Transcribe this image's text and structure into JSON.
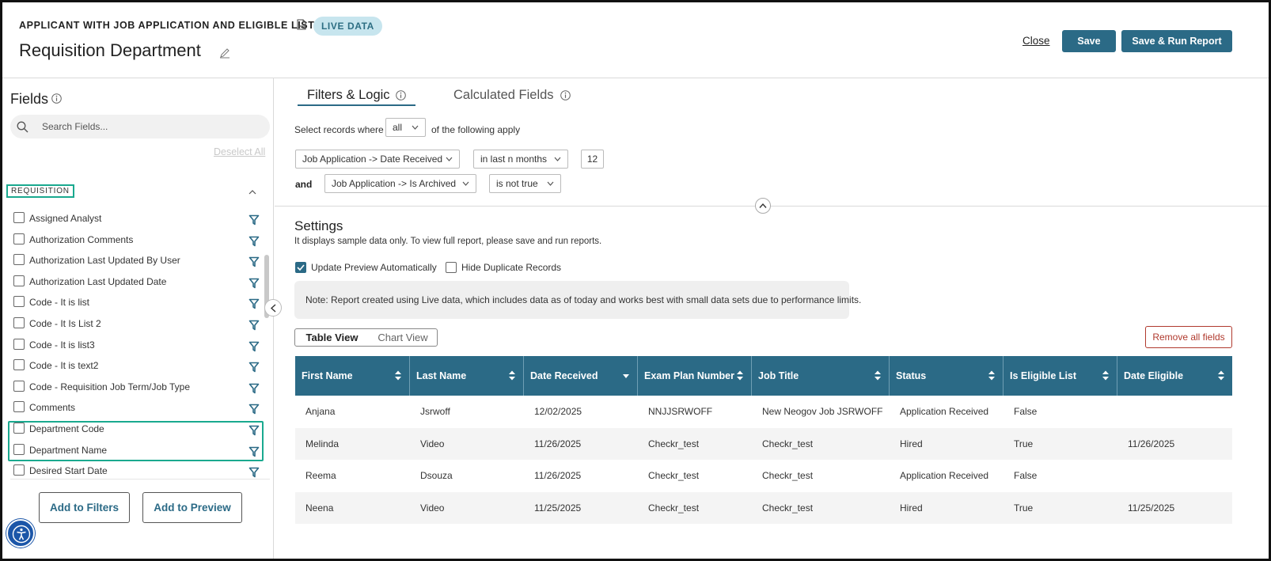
{
  "header": {
    "report_type": "APPLICANT WITH JOB APPLICATION AND ELIGIBLE LIST",
    "badge": "LIVE DATA",
    "title": "Requisition Department",
    "close_label": "Close",
    "save_label": "Save",
    "save_run_label": "Save & Run Report"
  },
  "sidebar": {
    "title": "Fields",
    "search_placeholder": "Search Fields...",
    "deselect_label": "Deselect All",
    "section_label": "REQUISITION",
    "fields": [
      "Assigned Analyst",
      "Authorization Comments",
      "Authorization Last Updated By User",
      "Authorization Last Updated Date",
      "Code - It is list",
      "Code - It Is List 2",
      "Code - It is list3",
      "Code - It is text2",
      "Code - Requisition Job Term/Job Type",
      "Comments",
      "Department Code",
      "Department Name",
      "Desired Start Date"
    ],
    "add_filters_label": "Add to Filters",
    "add_preview_label": "Add to Preview"
  },
  "tabs": {
    "filters": "Filters & Logic",
    "calculated": "Calculated Fields"
  },
  "filters": {
    "select_prefix": "Select records where",
    "match_value": "all",
    "select_suffix": "of the following apply",
    "conditions": [
      {
        "field": "Job Application -> Date Received",
        "operator": "in last n months",
        "value": "12"
      },
      {
        "connector": "and",
        "field": "Job Application -> Is Archived",
        "operator": "is not true"
      }
    ]
  },
  "settings": {
    "title": "Settings",
    "description": "It displays sample data only. To view full report, please save and run reports.",
    "update_preview_label": "Update Preview Automatically",
    "update_preview_checked": true,
    "hide_duplicates_label": "Hide Duplicate Records",
    "hide_duplicates_checked": false,
    "note": "Note: Report created using Live data, which includes data as of today and works best with small data sets due to performance limits."
  },
  "view_toggle": {
    "table": "Table View",
    "chart": "Chart View",
    "active": "table"
  },
  "remove_all_label": "Remove all fields",
  "table": {
    "columns": [
      "First Name",
      "Last Name",
      "Date Received",
      "Exam Plan Number",
      "Job Title",
      "Status",
      "Is Eligible List",
      "Date Eligible"
    ],
    "rows": [
      [
        "Anjana",
        "Jsrwoff",
        "12/02/2025",
        "NNJJSRWOFF",
        "New Neogov Job JSRWOFF",
        "Application Received",
        "False",
        ""
      ],
      [
        "Melinda",
        "Video",
        "11/26/2025",
        "Checkr_test",
        "Checkr_test",
        "Hired",
        "True",
        "11/26/2025"
      ],
      [
        "Reema",
        "Dsouza",
        "11/26/2025",
        "Checkr_test",
        "Checkr_test",
        "Application Received",
        "False",
        ""
      ],
      [
        "Neena",
        "Video",
        "11/25/2025",
        "Checkr_test",
        "Checkr_test",
        "Hired",
        "True",
        "11/25/2025"
      ]
    ]
  },
  "colors": {
    "primary": "#2b6a86",
    "highlight": "#1aa98f",
    "badge_bg": "#c7e5ee",
    "danger": "#b03a2e"
  },
  "icons": [
    "pdf-icon",
    "edit-icon",
    "info-icon",
    "search-icon",
    "filter-icon",
    "chevron-up-icon",
    "chevron-left-icon",
    "chevron-down-icon",
    "sort-icon",
    "accessibility-icon"
  ]
}
